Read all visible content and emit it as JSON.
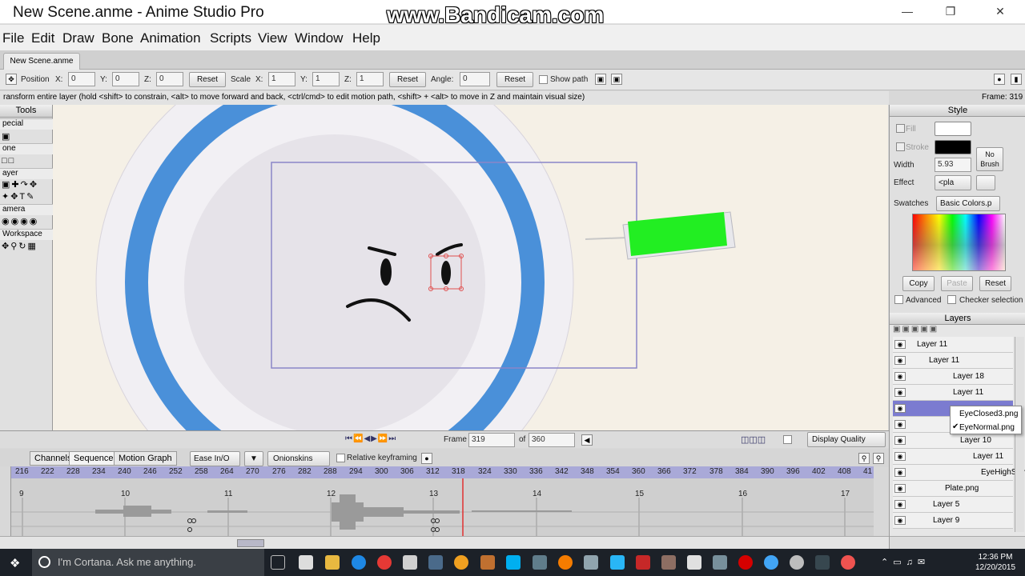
{
  "window": {
    "title": "New Scene.anme - Anime Studio Pro",
    "watermark": "www.Bandicam.com"
  },
  "menu": [
    "File",
    "Edit",
    "Draw",
    "Bone",
    "Animation",
    "Scripts",
    "View",
    "Window",
    "Help"
  ],
  "doc_tab": "New Scene.anme",
  "tool_options": {
    "position_label": "Position",
    "x": "X:",
    "y": "Y:",
    "z": "Z:",
    "pos_x": "0",
    "pos_y": "0",
    "pos_z": "0",
    "reset": "Reset",
    "scale_label": "Scale",
    "scale_x": "1",
    "scale_y": "1",
    "scale_z": "1",
    "angle_label": "Angle:",
    "angle": "0",
    "show_path": "Show path"
  },
  "status": "ransform entire layer (hold <shift> to constrain, <alt> to move forward and back, <ctrl/cmd> to edit motion path, <shift> + <alt> to move in Z and maintain visual size)",
  "frame_status": "Frame: 319",
  "tools": {
    "header": "Tools",
    "groups": [
      "pecial",
      "one",
      "ayer",
      "amera",
      "Workspace"
    ]
  },
  "framebar": {
    "frame_label": "Frame",
    "frame": "319",
    "of": "of",
    "total": "360",
    "display_quality": "Display Quality"
  },
  "timeline": {
    "tabs": [
      "Channels",
      "Sequencer",
      "Motion Graph"
    ],
    "ease": "Ease In/O",
    "onionskins": "Onionskins",
    "relative_keyframing": "Relative keyframing",
    "ruler": [
      "216",
      "222",
      "228",
      "234",
      "240",
      "246",
      "252",
      "258",
      "264",
      "270",
      "276",
      "282",
      "288",
      "294",
      "300",
      "306",
      "312",
      "318",
      "324",
      "330",
      "336",
      "342",
      "348",
      "354",
      "360",
      "366",
      "372",
      "378",
      "384",
      "390",
      "396",
      "402",
      "408",
      "41"
    ],
    "seconds": [
      "9",
      "10",
      "11",
      "12",
      "13",
      "14",
      "15",
      "16",
      "17"
    ],
    "playhead_frame": 318
  },
  "style": {
    "header": "Style",
    "fill": "Fill",
    "stroke": "Stroke",
    "width_label": "Width",
    "width": "5.93",
    "no_brush": "No\nBrush",
    "effect_label": "Effect",
    "effect": "<pla",
    "swatches_label": "Swatches",
    "swatches": "Basic Colors.p",
    "copy": "Copy",
    "paste": "Paste",
    "reset": "Reset",
    "advanced": "Advanced",
    "checker": "Checker selection",
    "fill_color": "#ffffff",
    "stroke_color": "#000000"
  },
  "layers": {
    "header": "Layers",
    "rows": [
      "Layer 11",
      "Layer 11",
      "Layer 18",
      "Layer 11",
      "",
      "",
      "Layer 10",
      "Layer 11",
      "EyeHighSlar",
      "Plate.png",
      "Layer 5",
      "Layer 9"
    ],
    "popup": [
      "EyeClosed3.png",
      "EyeNormal.png"
    ]
  },
  "taskbar": {
    "search": "I'm Cortana. Ask me anything.",
    "time": "12:36 PM",
    "date": "12/20/2015"
  },
  "colors": {
    "accent": "#4a90d9",
    "syringe": "#22ee22",
    "selected_layer": "#7b7bd0"
  }
}
